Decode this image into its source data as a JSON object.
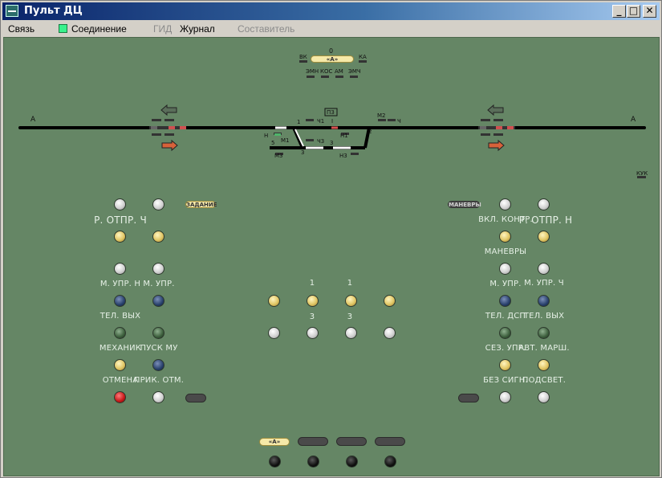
{
  "window": {
    "title": "Пульт ДЦ"
  },
  "menu": [
    {
      "label": "Связь",
      "enabled": true
    },
    {
      "label": "Соединение",
      "enabled": true
    },
    {
      "label": "ГИД",
      "enabled": false
    },
    {
      "label": "Журнал",
      "enabled": true
    },
    {
      "label": "Составитель",
      "enabled": false
    }
  ],
  "colors": {
    "panel": "#658665",
    "track": "#000000",
    "connection_indicator": "#39f28c"
  },
  "top_block": {
    "zero": "0",
    "vk": "ВК",
    "ka": "КА",
    "center": "«А»",
    "indicators": [
      "ЭМН",
      "КОС",
      "АМ",
      "ЭМЧ"
    ]
  },
  "schematic": {
    "left_a": "А",
    "right_a": "А",
    "station_box": "ПЗ",
    "kuk": "КУК",
    "labels": {
      "l1": "1",
      "ch1": "Ч1",
      "track1": "I",
      "m2": "М2",
      "ch": "Ч",
      "n1": "Н1",
      "n": "Н",
      "m1": "М1",
      "l5": "5",
      "ch3": "Ч3",
      "l3": "3",
      "l3b": "3",
      "m3": "М3",
      "n3": "Н3",
      "l2": "2"
    }
  },
  "buttons": {
    "task": "ЗАДАНИЕ",
    "maneuvers": "МАНЕВРЫ",
    "bottom": "«А»"
  },
  "left_labels": [
    "Р. ОТПР. Ч",
    "М. УПР. Н",
    "М. УПР.",
    "ТЕЛ. ВЫХ",
    "МЕХАНИК",
    "ПУСК МУ",
    "ОТМЕНА",
    "ПРИК. ОТМ."
  ],
  "right_labels": [
    "ВКЛ. КОНТР.",
    "Р. ОТПР. Н",
    "МАНЕВРЫ",
    "М. УПР.",
    "М. УПР. Ч",
    "ТЕЛ. ДСП",
    "ТЕЛ. ВЫХ",
    "СЕЗ. УПР.",
    "АВТ. МАРШ.",
    "БЕЗ СИГН.",
    "ПОДСВЕТ."
  ],
  "center_labels": {
    "c1a": "1",
    "c1b": "1",
    "c3a": "3",
    "c3b": "3"
  }
}
